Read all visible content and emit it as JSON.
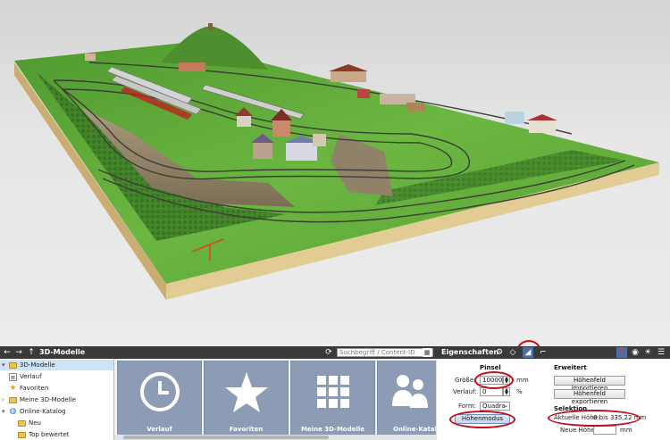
{
  "toolbar": {
    "panel_title": "3D-Modelle",
    "search_placeholder": "Suchbegriff / Content-ID",
    "properties_title": "Eigenschaften",
    "icons": [
      "back-icon",
      "forward-icon",
      "up-icon",
      "refresh-icon",
      "clear-icon",
      "settings-icon",
      "brush-icon",
      "terrain-icon",
      "selection-icon",
      "pin-icon",
      "eye-icon",
      "sun-icon",
      "menu-icon"
    ]
  },
  "tree": {
    "items": [
      {
        "label": "3D-Modelle",
        "icon": "folder-icon",
        "expander": "▾"
      },
      {
        "label": "Verlauf",
        "icon": "history-icon",
        "expander": ""
      },
      {
        "label": "Favoriten",
        "icon": "star-icon",
        "expander": ""
      },
      {
        "label": "Meine 3D-Modelle",
        "icon": "folder-icon",
        "expander": "›"
      },
      {
        "label": "Online-Katalog",
        "icon": "globe-icon",
        "expander": "▾"
      },
      {
        "label": "Neu",
        "icon": "folder-icon",
        "expander": ""
      },
      {
        "label": "Top bewertet",
        "icon": "folder-icon",
        "expander": ""
      }
    ]
  },
  "tiles": [
    {
      "label": "Verlauf",
      "icon": "clock-icon"
    },
    {
      "label": "Favoriten",
      "icon": "star-icon"
    },
    {
      "label": "Meine 3D-Modelle",
      "icon": "grid-icon"
    },
    {
      "label": "Online-Katal",
      "icon": "people-icon"
    }
  ],
  "properties": {
    "brush_heading": "Pinsel",
    "size_label": "Größe:",
    "size_value": "10000",
    "size_unit": "mm",
    "falloff_label": "Verlauf:",
    "falloff_value": "0",
    "falloff_unit": "%",
    "form_label": "Form:",
    "form_value": "Quadra",
    "height_mode_button": "Höhenmodus",
    "advanced_heading": "Erweitert",
    "import_button": "Höhenfeld importieren",
    "export_button": "Höhenfeld exportieren",
    "selection_heading": "Selektion",
    "current_height_label": "Aktuelle Höhe:",
    "current_height_value": "0 bis 335,22 mm",
    "new_height_label": "Neue Höhe:",
    "new_height_value": "",
    "new_height_unit": "mm"
  },
  "colors": {
    "highlight": "#c0101c",
    "toolbar_bg": "#3a3a3a",
    "tile_bg": "#8b9cb4",
    "grass": "#5fa83a",
    "baseboard": "#d9c08a"
  }
}
